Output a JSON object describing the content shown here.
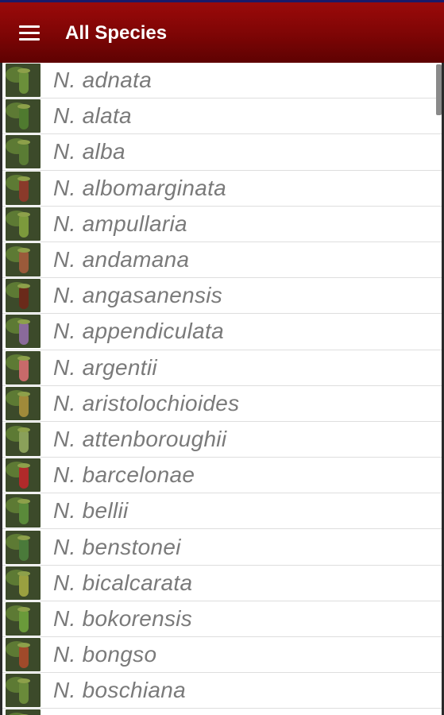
{
  "toolbar": {
    "title": "All Species",
    "menu_icon": "hamburger-menu-icon",
    "background": "#7d0505"
  },
  "species": [
    {
      "name": "N. adnata",
      "thumb": "#6b8f3a"
    },
    {
      "name": "N. alata",
      "thumb": "#4f7a2f"
    },
    {
      "name": "N. alba",
      "thumb": "#5a7c34"
    },
    {
      "name": "N. albomarginata",
      "thumb": "#8a3a2a"
    },
    {
      "name": "N. ampullaria",
      "thumb": "#7c9a3c"
    },
    {
      "name": "N. andamana",
      "thumb": "#9a5a3a"
    },
    {
      "name": "N. angasanensis",
      "thumb": "#6a2a1a"
    },
    {
      "name": "N. appendiculata",
      "thumb": "#8a6a9a"
    },
    {
      "name": "N. argentii",
      "thumb": "#c86a6a"
    },
    {
      "name": "N. aristolochioides",
      "thumb": "#a08a3a"
    },
    {
      "name": "N. attenboroughii",
      "thumb": "#8aa05a"
    },
    {
      "name": "N. barcelonae",
      "thumb": "#b02a2a"
    },
    {
      "name": "N. bellii",
      "thumb": "#5a8a3a"
    },
    {
      "name": "N. benstonei",
      "thumb": "#4a7a3a"
    },
    {
      "name": "N. bicalcarata",
      "thumb": "#9aa040"
    },
    {
      "name": "N. bokorensis",
      "thumb": "#6a9a3a"
    },
    {
      "name": "N. bongso",
      "thumb": "#a04a2a"
    },
    {
      "name": "N. boschiana",
      "thumb": "#6a8a3a"
    },
    {
      "name": "",
      "thumb": "#5a7a30"
    }
  ]
}
